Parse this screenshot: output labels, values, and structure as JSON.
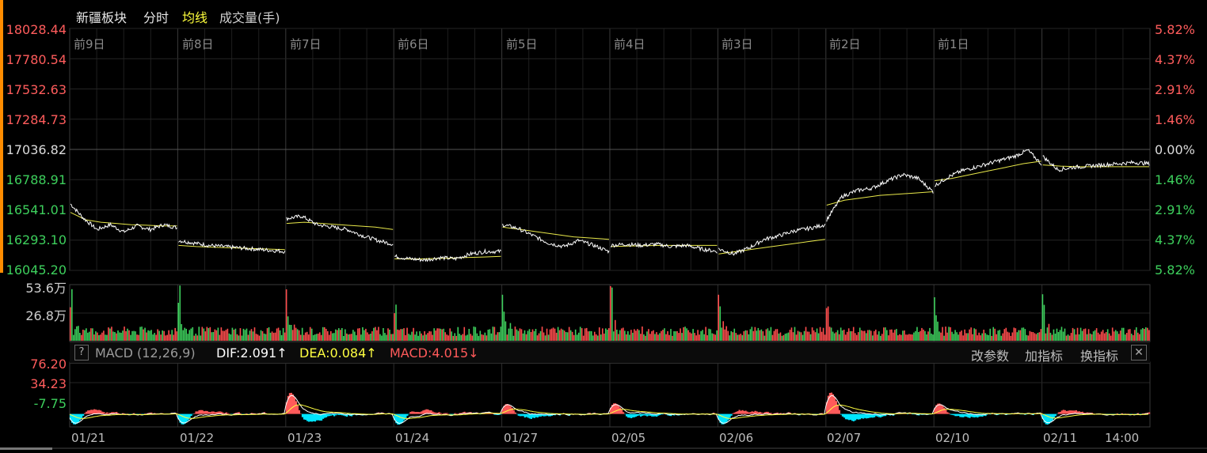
{
  "header": {
    "title": "新疆板块",
    "tab_intraday": "分时",
    "tab_avg": "均线",
    "tab_volume": "成交量(手)"
  },
  "price_axis_left": [
    "18028.44",
    "17780.54",
    "17532.63",
    "17284.73",
    "17036.82",
    "16788.91",
    "16541.01",
    "16293.10",
    "16045.20"
  ],
  "price_axis_right": [
    "5.82%",
    "4.37%",
    "2.91%",
    "1.46%",
    "0.00%",
    "1.46%",
    "2.91%",
    "4.37%",
    "5.82%"
  ],
  "day_labels": [
    "前9日",
    "前8日",
    "前7日",
    "前6日",
    "前5日",
    "前4日",
    "前3日",
    "前2日",
    "前1日"
  ],
  "volume_axis": [
    "53.6万",
    "26.8万"
  ],
  "macd": {
    "help": "?",
    "name": "MACD (12,26,9)",
    "dif": "DIF:2.091↑",
    "dea": "DEA:0.084↑",
    "macd": "MACD:4.015↓",
    "btn_params": "改参数",
    "btn_add": "加指标",
    "btn_switch": "换指标",
    "close": "✕",
    "axis": [
      "76.20",
      "34.23",
      "-7.75"
    ]
  },
  "date_labels": [
    "01/21",
    "01/22",
    "01/23",
    "01/24",
    "01/27",
    "02/05",
    "02/06",
    "02/07",
    "02/10",
    "02/11",
    "14:00"
  ],
  "colors": {
    "up": "#ff4d4d",
    "down": "#3dcf5c",
    "price_line": "#ffffff",
    "avg_line": "#e8e84a",
    "macd_pos": "#ff5a5a",
    "macd_neg": "#00e5ff",
    "dea_line": "#ffff40",
    "dif_line": "#ffffff",
    "highlight": "#ff8c00"
  },
  "chart_data": {
    "type": "line",
    "title": "新疆板块",
    "ylim": [
      16045.2,
      18028.44
    ],
    "ticks_y": [
      18028.44,
      17780.54,
      17532.63,
      17284.73,
      17036.82,
      16788.91,
      16541.01,
      16293.1,
      16045.2
    ],
    "reference_price": 17036.82,
    "x_categories": [
      "01/21",
      "01/22",
      "01/23",
      "01/24",
      "01/27",
      "02/05",
      "02/06",
      "02/07",
      "02/10",
      "02/11"
    ],
    "series": [
      {
        "name": "分时",
        "days": [
          [
            16590,
            16470,
            16380,
            16420,
            16360,
            16410,
            16380,
            16420,
            16395
          ],
          [
            16290,
            16270,
            16250,
            16240,
            16230,
            16220,
            16210,
            16200
          ],
          [
            16470,
            16490,
            16420,
            16400,
            16380,
            16330,
            16290,
            16260
          ],
          [
            16160,
            16140,
            16130,
            16150,
            16140,
            16180,
            16200,
            16200
          ],
          [
            16420,
            16390,
            16330,
            16270,
            16240,
            16290,
            16250,
            16200
          ],
          [
            16250,
            16260,
            16250,
            16260,
            16240,
            16250,
            16220,
            16200
          ],
          [
            16220,
            16180,
            16230,
            16300,
            16330,
            16370,
            16390,
            16420
          ],
          [
            16460,
            16650,
            16700,
            16720,
            16780,
            16830,
            16800,
            16690
          ],
          [
            16740,
            16810,
            16860,
            16890,
            16920,
            16950,
            16980,
            17030,
            16920
          ],
          [
            16980,
            16870,
            16890,
            16900,
            16910,
            16920,
            16930,
            16920
          ]
        ]
      },
      {
        "name": "均线",
        "days": [
          [
            16520,
            16460,
            16440,
            16430,
            16420,
            16415,
            16410,
            16410
          ],
          [
            16250,
            16240,
            16235,
            16230,
            16225,
            16220,
            16215
          ],
          [
            16430,
            16440,
            16430,
            16420,
            16410,
            16400,
            16380
          ],
          [
            16140,
            16138,
            16142,
            16145,
            16150,
            16155,
            16160
          ],
          [
            16400,
            16380,
            16360,
            16340,
            16320,
            16310,
            16300
          ],
          [
            16240,
            16245,
            16248,
            16250,
            16250,
            16250,
            16250
          ],
          [
            16180,
            16200,
            16220,
            16240,
            16260,
            16280,
            16300
          ],
          [
            16580,
            16620,
            16640,
            16660,
            16670,
            16680,
            16690
          ],
          [
            16780,
            16800,
            16830,
            16860,
            16890,
            16920,
            16940
          ],
          [
            16910,
            16900,
            16895,
            16895,
            16895,
            16895,
            16895
          ]
        ]
      }
    ],
    "volume": {
      "ylim": [
        0,
        536000
      ],
      "ticks": [
        "53.6万",
        "26.8万"
      ]
    },
    "macd": {
      "ylim": [
        -20,
        80
      ],
      "ticks": [
        76.2,
        34.23,
        -7.75
      ]
    }
  }
}
